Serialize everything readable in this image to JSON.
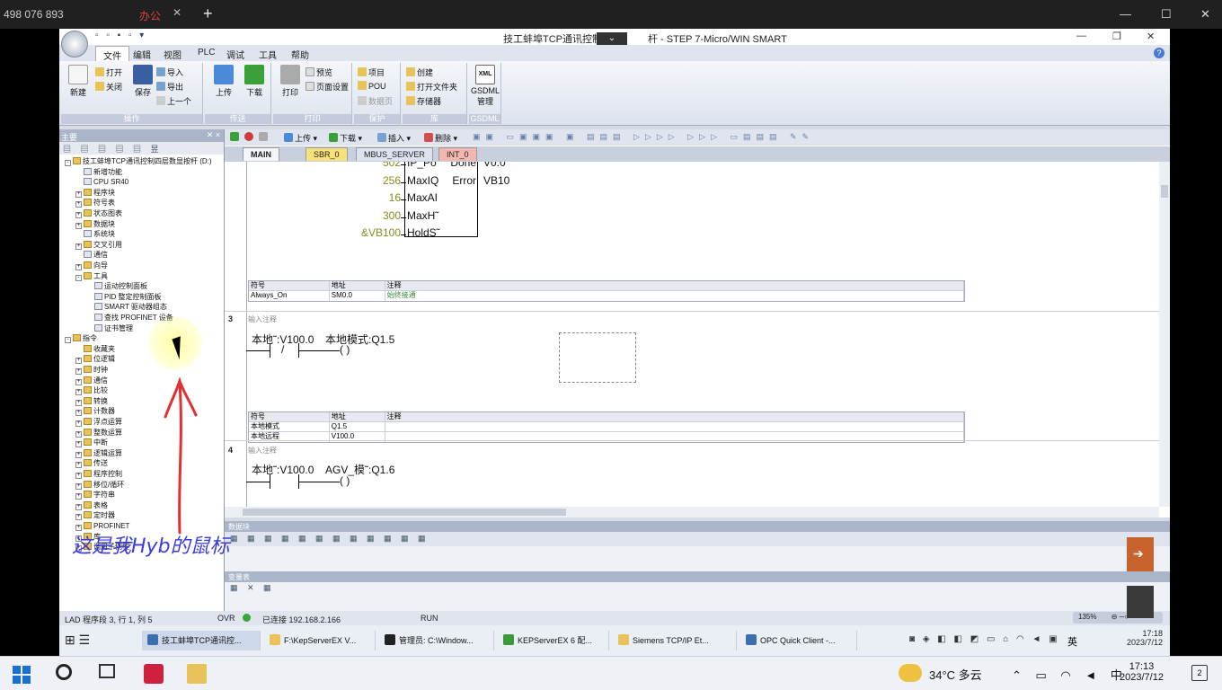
{
  "outer": {
    "title": "498 076 893",
    "tab": "办公",
    "close": "✕",
    "plus": "+",
    "min": "—",
    "max": "☐",
    "closewin": "✕"
  },
  "app": {
    "title": "技工蚌埠TCP通讯控制四层数显按杆 - STEP 7-Micro/WIN SMART",
    "title_visible": "技工蚌埠TCP通讯控制四",
    "title_suffix": "杆 - STEP 7-Micro/WIN SMART",
    "qat": "▫ ▫ ▪ ▫ ▾",
    "min": "—",
    "max": "❐",
    "close": "✕"
  },
  "menu": [
    "文件",
    "编辑",
    "视图",
    "PLC",
    "调试",
    "工具",
    "帮助"
  ],
  "ribbon": {
    "file": {
      "new": "新建",
      "open": "打开",
      "close": "关闭",
      "save": "保存",
      "import": "导入",
      "export": "导出",
      "prev": "上一个",
      "group": "操作"
    },
    "transfer": {
      "upload": "上传",
      "download": "下载",
      "group": "传送"
    },
    "print": {
      "print": "打印",
      "preview": "预览",
      "setup": "页面设置",
      "group": "打印"
    },
    "protect": {
      "project": "项目",
      "pou": "POU",
      "datablock": "数据页",
      "group": "保护"
    },
    "lib": {
      "create": "创建",
      "openfolder": "打开文件夹",
      "storage": "存储器",
      "group": "库"
    },
    "gsdml": {
      "label": "GSDML",
      "label2": "管理",
      "group": "GSDML",
      "xml": "XML"
    }
  },
  "leftpane": {
    "title": "主要",
    "close": "✕ ×",
    "tools": "▤ ▤ ▤ ▤ ▤ 昱"
  },
  "tree": [
    {
      "label": "技工蚌埠TCP通讯控制四层数显按杆 (D:)",
      "indent": 0,
      "box": "⊟",
      "doc": false
    },
    {
      "label": "新增功能",
      "indent": 1,
      "box": "",
      "doc": true
    },
    {
      "label": "CPU SR40",
      "indent": 1,
      "box": "",
      "doc": true
    },
    {
      "label": "程序块",
      "indent": 1,
      "box": "⊞",
      "doc": false
    },
    {
      "label": "符号表",
      "indent": 1,
      "box": "⊞",
      "doc": false
    },
    {
      "label": "状态图表",
      "indent": 1,
      "box": "⊞",
      "doc": false
    },
    {
      "label": "数据块",
      "indent": 1,
      "box": "⊞",
      "doc": false
    },
    {
      "label": "系统块",
      "indent": 1,
      "box": "",
      "doc": true
    },
    {
      "label": "交叉引用",
      "indent": 1,
      "box": "⊞",
      "doc": false
    },
    {
      "label": "通信",
      "indent": 1,
      "box": "",
      "doc": true
    },
    {
      "label": "向导",
      "indent": 1,
      "box": "⊞",
      "doc": false
    },
    {
      "label": "工具",
      "indent": 1,
      "box": "⊟",
      "doc": false
    },
    {
      "label": "运动控制面板",
      "indent": 2,
      "box": "",
      "doc": true
    },
    {
      "label": "PID 整定控制面板",
      "indent": 2,
      "box": "",
      "doc": true
    },
    {
      "label": "SMART 驱动器组态",
      "indent": 2,
      "box": "",
      "doc": true
    },
    {
      "label": "查找 PROFINET 设备",
      "indent": 2,
      "box": "",
      "doc": true
    },
    {
      "label": "证书管理",
      "indent": 2,
      "box": "",
      "doc": true
    },
    {
      "label": "指令",
      "indent": 0,
      "box": "⊟",
      "doc": false
    },
    {
      "label": "收藏夹",
      "indent": 1,
      "box": "",
      "doc": false
    },
    {
      "label": "位逻辑",
      "indent": 1,
      "box": "⊞",
      "doc": false
    },
    {
      "label": "时钟",
      "indent": 1,
      "box": "⊞",
      "doc": false
    },
    {
      "label": "通信",
      "indent": 1,
      "box": "⊞",
      "doc": false
    },
    {
      "label": "比较",
      "indent": 1,
      "box": "⊞",
      "doc": false
    },
    {
      "label": "转换",
      "indent": 1,
      "box": "⊞",
      "doc": false
    },
    {
      "label": "计数器",
      "indent": 1,
      "box": "⊞",
      "doc": false
    },
    {
      "label": "浮点运算",
      "indent": 1,
      "box": "⊞",
      "doc": false
    },
    {
      "label": "整数运算",
      "indent": 1,
      "box": "⊞",
      "doc": false
    },
    {
      "label": "中断",
      "indent": 1,
      "box": "⊞",
      "doc": false
    },
    {
      "label": "逻辑运算",
      "indent": 1,
      "box": "⊞",
      "doc": false
    },
    {
      "label": "传送",
      "indent": 1,
      "box": "⊞",
      "doc": false
    },
    {
      "label": "程序控制",
      "indent": 1,
      "box": "⊞",
      "doc": false
    },
    {
      "label": "移位/循环",
      "indent": 1,
      "box": "⊞",
      "doc": false
    },
    {
      "label": "字符串",
      "indent": 1,
      "box": "⊞",
      "doc": false
    },
    {
      "label": "表格",
      "indent": 1,
      "box": "⊞",
      "doc": false
    },
    {
      "label": "定时器",
      "indent": 1,
      "box": "⊞",
      "doc": false
    },
    {
      "label": "PROFINET",
      "indent": 1,
      "box": "⊞",
      "doc": false
    },
    {
      "label": "库",
      "indent": 1,
      "box": "⊞",
      "doc": false
    },
    {
      "label": "调用子例程",
      "indent": 1,
      "box": "⊞",
      "doc": false
    }
  ],
  "edtoolbar": {
    "upload": "上传",
    "download": "下载",
    "insert": "插入",
    "delete": "删除"
  },
  "tabs": [
    {
      "label": "MAIN",
      "color": "#f3f5fa",
      "bold": true
    },
    {
      "label": "SBR_0",
      "color": "#f7e27a",
      "bold": false
    },
    {
      "label": "MBUS_SERVER",
      "color": "#dde3ee",
      "bold": false
    },
    {
      "label": "INT_0",
      "color": "#f2b8b0",
      "bold": false
    }
  ],
  "net2": {
    "left_params": [
      {
        "val": "502",
        "pin": "IP_Po"
      },
      {
        "val": "256",
        "pin": "MaxIQ"
      },
      {
        "val": "16",
        "pin": "MaxAI"
      },
      {
        "val": "300",
        "pin": "MaxH˜"
      },
      {
        "val": "&VB100",
        "pin": "HoldS˜"
      }
    ],
    "right_params": [
      {
        "pin": "Done",
        "val": "V0.0"
      },
      {
        "pin": "Error",
        "val": "VB10"
      }
    ],
    "table": {
      "h": [
        "符号",
        "地址",
        "注释"
      ],
      "rows": [
        [
          "Always_On",
          "SM0.0",
          "始终接通"
        ]
      ]
    }
  },
  "net3": {
    "num": "3",
    "comment": "输入注释",
    "c1": "本地˜:V100.0",
    "c2": "本地模式:Q1.5",
    "contact": "/",
    "coil": "(      )",
    "table": {
      "h": [
        "符号",
        "地址",
        "注释"
      ],
      "rows": [
        [
          "本地模式",
          "Q1.5",
          ""
        ],
        [
          "本地远程",
          "V100.0",
          ""
        ]
      ]
    }
  },
  "net4": {
    "num": "4",
    "comment": "输入注释",
    "c1": "本地˜:V100.0",
    "c2": "AGV_模˜:Q1.6",
    "coil": "(      )"
  },
  "dataview": {
    "title": "数据块",
    "tools": "▦ ▦ ▦ ▦ ▦ ▦ ▦ ▦ ▦ ▦ ▦ ▦"
  },
  "statusview": {
    "title": "变量表",
    "tools": "▦ ✕ ▦"
  },
  "status": {
    "mode": "LAD 程序段 3, 行 1, 列 5",
    "ovr": "OVR",
    "conn": "已连接 192.168.2.166",
    "run": "RUN",
    "zoom": "135%"
  },
  "inner_taskbar": [
    {
      "label": "技工蚌埠TCP通讯控...",
      "color": "#3a6fb0",
      "active": true
    },
    {
      "label": "F:\\KepServerEX V...",
      "color": "#e8c35a",
      "active": false
    },
    {
      "label": "管理员: C:\\Window...",
      "color": "#222",
      "active": false
    },
    {
      "label": "KEPServerEX 6 配...",
      "color": "#3a9a3a",
      "active": false
    },
    {
      "label": "Siemens TCP/IP Et...",
      "color": "#e8c35a",
      "active": false
    },
    {
      "label": "OPC Quick Client -...",
      "color": "#3a6fb0",
      "active": false
    }
  ],
  "inner_tray": {
    "time": "17:18",
    "date": "2023/7/12",
    "ime": "英",
    "icons": "◙ ◈ ◧ ◧ ◩ ▭ ⌂ ◠ ◄ ▣"
  },
  "taskbar": {
    "weather": "34°C 多云",
    "ime": "中",
    "time": "17:13",
    "date": "2023/7/12",
    "tray": "⌃ ▭ ◠ ◄ 中",
    "notif": "2"
  },
  "annotation": "这是我Hyb的鼠标"
}
